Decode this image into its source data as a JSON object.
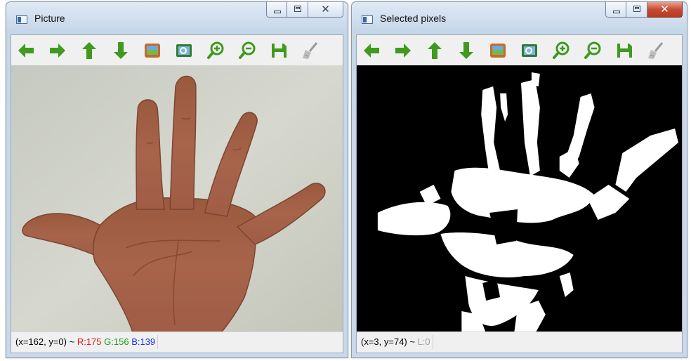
{
  "windows": [
    {
      "title": "Picture",
      "status": {
        "coord": "(x=162, y=0) ~ ",
        "r": "R:175",
        "g": "G:156",
        "b": "B:139"
      }
    },
    {
      "title": "Selected pixels",
      "status": {
        "coord": "(x=3, y=74) ~ ",
        "l": "L:0"
      }
    }
  ],
  "caption_buttons": {
    "minimize": "minimize",
    "maximize": "maximize",
    "close": "close"
  },
  "toolbar_icons": [
    "arrow-left-icon",
    "arrow-right-icon",
    "arrow-up-icon",
    "arrow-down-icon",
    "fit-image-icon",
    "zoom-fit-icon",
    "zoom-in-icon",
    "zoom-out-icon",
    "save-icon",
    "clear-brush-icon"
  ],
  "colors": {
    "icon_green": "#3f9a1e",
    "selected_background": "#000000",
    "selected_pixels": "#ffffff",
    "status_red": "#e8141b",
    "status_green": "#1f9a25",
    "status_blue": "#1533ea"
  }
}
